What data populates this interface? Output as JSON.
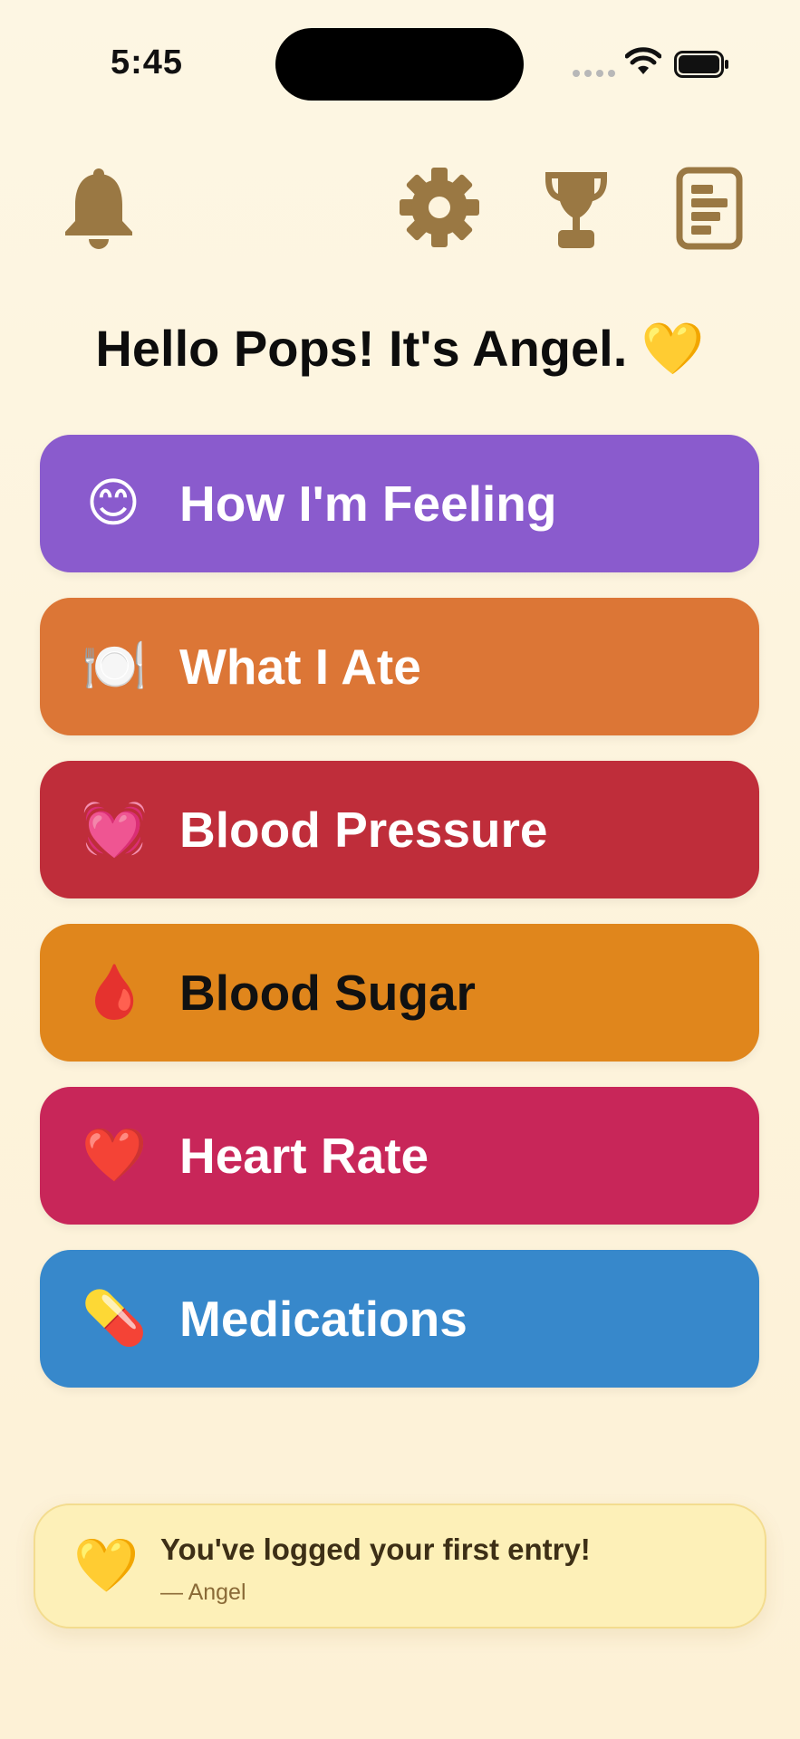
{
  "status_bar": {
    "time": "5:45",
    "icons": [
      "cellular-signal-icon",
      "wifi-icon",
      "battery-icon"
    ]
  },
  "toolbar": {
    "icon_color": "#9a7843",
    "left": [
      "bell-icon"
    ],
    "right": [
      "gear-icon",
      "trophy-icon",
      "report-icon"
    ]
  },
  "greeting": "Hello Pops! It's Angel. 💛",
  "menu": [
    {
      "emoji": "😊",
      "label": "How I'm Feeling",
      "color": "#8a5bcd",
      "text_color": "#ffffff"
    },
    {
      "emoji": "🍽️",
      "label": "What I Ate",
      "color": "#dc7636",
      "text_color": "#ffffff"
    },
    {
      "emoji": "💓",
      "label": "Blood Pressure",
      "color": "#bf2d3a",
      "text_color": "#ffffff"
    },
    {
      "emoji": "🩸",
      "label": "Blood Sugar",
      "color": "#e0861c",
      "text_color": "#111111"
    },
    {
      "emoji": "❤️",
      "label": "Heart Rate",
      "color": "#c82659",
      "text_color": "#ffffff"
    },
    {
      "emoji": "💊",
      "label": "Medications",
      "color": "#3788cb",
      "text_color": "#ffffff"
    }
  ],
  "toast": {
    "emoji": "💛",
    "title": "You've logged your first entry!",
    "signature": "— Angel"
  }
}
